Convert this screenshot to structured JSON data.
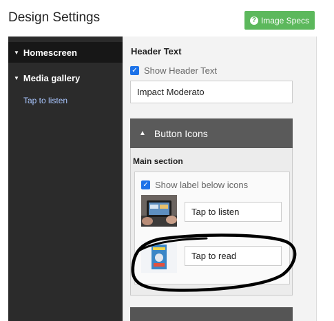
{
  "header": {
    "title": "Design Settings",
    "specs_button": "Image Specs"
  },
  "sidebar": {
    "items": [
      {
        "label": "Homescreen",
        "active": true
      },
      {
        "label": "Media gallery",
        "active": false
      }
    ],
    "sub_item": "Tap to listen"
  },
  "header_text": {
    "section_label": "Header Text",
    "show_label": "Show Header Text",
    "show_checked": true,
    "value": "Impact Moderato"
  },
  "button_icons": {
    "title": "Button Icons",
    "main_section_label": "Main section",
    "show_label_text": "Show label below icons",
    "show_label_checked": true,
    "icons": [
      {
        "label": "Tap to listen",
        "thumb": "tablet-photo"
      },
      {
        "label": "Tap to read",
        "thumb": "book-cover"
      }
    ]
  },
  "annotation": {
    "type": "hand-drawn black ellipse around Tap to read row",
    "color": "#000000"
  }
}
